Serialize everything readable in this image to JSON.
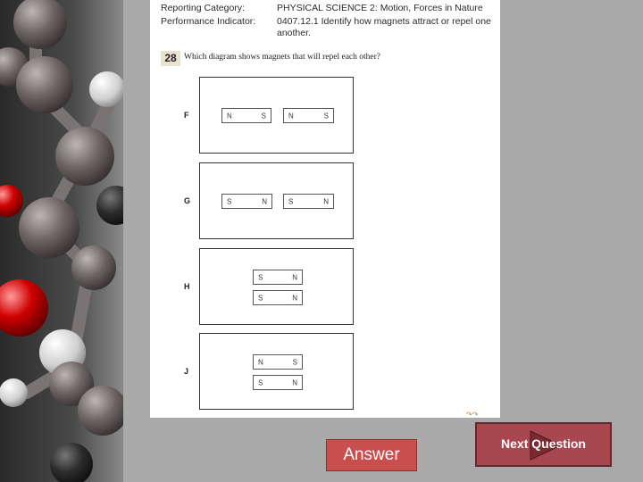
{
  "header": {
    "category_label": "Reporting Category:",
    "category_value": "PHYSICAL SCIENCE 2: Motion, Forces in Nature",
    "indicator_label": "Performance Indicator:",
    "indicator_value_1": "0407.12.1 Identify how magnets attract or repel one",
    "indicator_value_2": "another."
  },
  "question": {
    "number": "28",
    "text": "Which diagram shows magnets that will repel each other?"
  },
  "options": [
    {
      "letter": "F",
      "magnets": [
        [
          "N",
          "S"
        ],
        [
          "N",
          "S"
        ]
      ]
    },
    {
      "letter": "G",
      "magnets": [
        [
          "S",
          "N"
        ],
        [
          "S",
          "N"
        ]
      ]
    },
    {
      "letter": "H",
      "magnets": [
        [
          "S",
          "N"
        ],
        [
          "S",
          "N"
        ]
      ]
    },
    {
      "letter": "J",
      "magnets": [
        [
          "N",
          "S"
        ],
        [
          "S",
          "N"
        ]
      ]
    }
  ],
  "buttons": {
    "answer": "Answer",
    "next": "Next Question"
  },
  "colors": {
    "answer_button": "#c94e4e",
    "next_button": "#a8474f",
    "background": "#a9a9a9"
  }
}
